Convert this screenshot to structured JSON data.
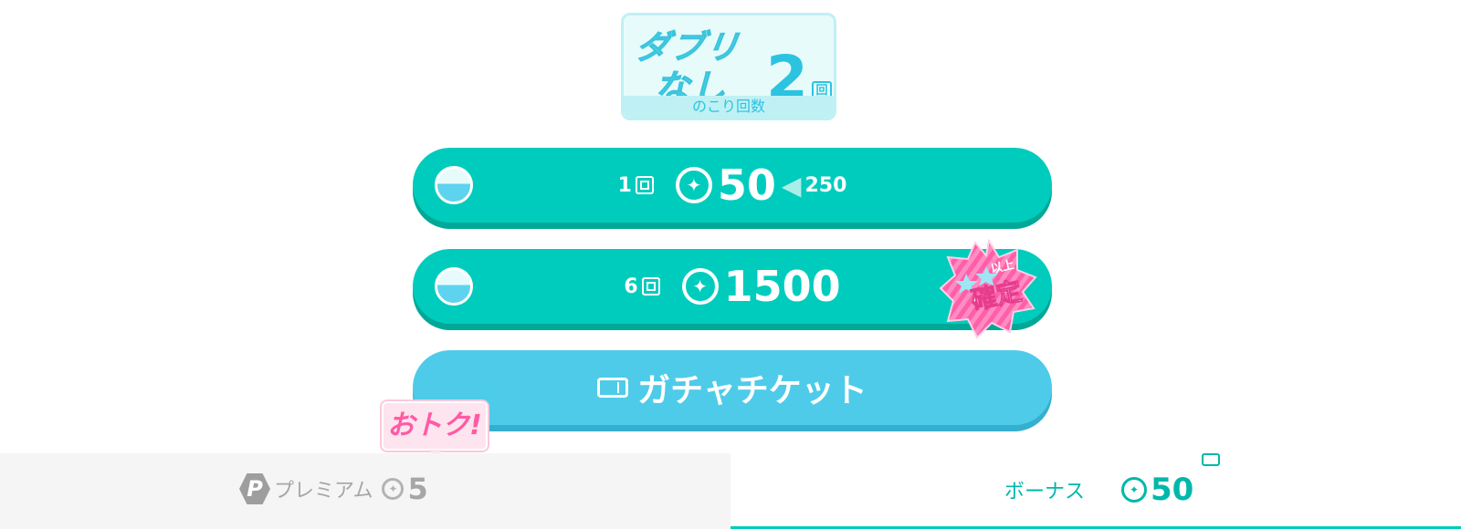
{
  "badge": {
    "line1": "ダブリ",
    "line2": "なし",
    "count": "2",
    "unit": "回",
    "subtitle": "のこり回数"
  },
  "buttons": [
    {
      "count": "1",
      "count_unit": "回",
      "coin_symbol": "✦",
      "price": "50",
      "old_price": "250"
    },
    {
      "count": "6",
      "count_unit": "回",
      "coin_symbol": "✦",
      "price": "1500",
      "badge_line1": "以上",
      "badge_line2": "確定"
    },
    {
      "label": "ガチャチケット"
    }
  ],
  "otoku_label": "おトク!",
  "tabs": {
    "premium": {
      "icon_letter": "P",
      "label": "プレミアム",
      "value": "5"
    },
    "bonus": {
      "label": "ボーナス",
      "value": "50"
    }
  },
  "colors": {
    "teal": "#00ccbd",
    "teal_shadow": "#01a898",
    "blue": "#4ecbe9",
    "pink": "#ff5aa5"
  }
}
